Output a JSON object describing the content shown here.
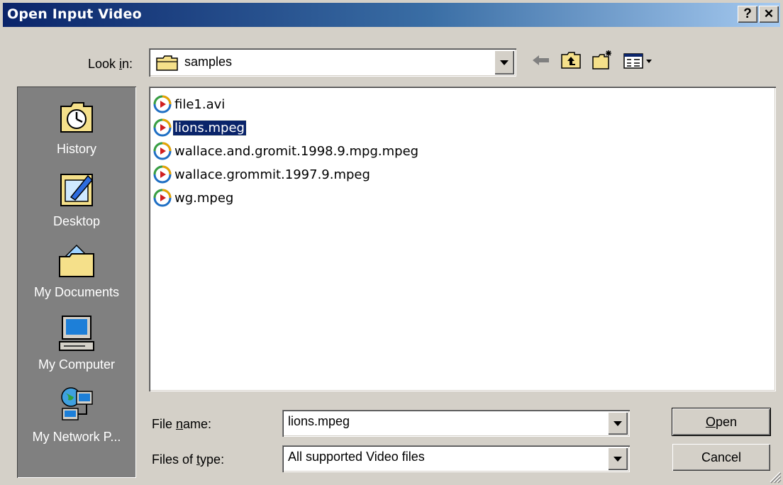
{
  "window": {
    "title": "Open Input Video",
    "help_label": "?",
    "close_label": "✕"
  },
  "toolbar": {
    "look_in_pre": "Look ",
    "look_in_key": "i",
    "look_in_post": "n:",
    "look_in_value": "samples",
    "icons": [
      "back-arrow-icon",
      "up-folder-icon",
      "new-folder-icon",
      "view-menu-icon"
    ]
  },
  "places": [
    {
      "label": "History",
      "icon": "history-icon"
    },
    {
      "label": "Desktop",
      "icon": "desktop-icon"
    },
    {
      "label": "My Documents",
      "icon": "my-documents-icon"
    },
    {
      "label": "My Computer",
      "icon": "my-computer-icon"
    },
    {
      "label": "My Network P...",
      "icon": "network-places-icon"
    }
  ],
  "files": [
    {
      "name": "file1.avi",
      "selected": false
    },
    {
      "name": "lions.mpeg",
      "selected": true
    },
    {
      "name": "wallace.and.gromit.1998.9.mpg.mpeg",
      "selected": false
    },
    {
      "name": "wallace.grommit.1997.9.mpeg",
      "selected": false
    },
    {
      "name": "wg.mpeg",
      "selected": false
    }
  ],
  "filename": {
    "pre": "File ",
    "key": "n",
    "post": "ame:",
    "value": "lions.mpeg"
  },
  "filetype": {
    "pre": "Files of ",
    "key": "t",
    "post": "ype:",
    "value": "All supported Video files"
  },
  "buttons": {
    "open_key": "O",
    "open_rest": "pen",
    "cancel": "Cancel"
  },
  "colors": {
    "title_start": "#0a246a",
    "title_end": "#a6caf0",
    "face": "#d4d0c8",
    "places_bg": "#808080",
    "selection": "#0a246a"
  }
}
